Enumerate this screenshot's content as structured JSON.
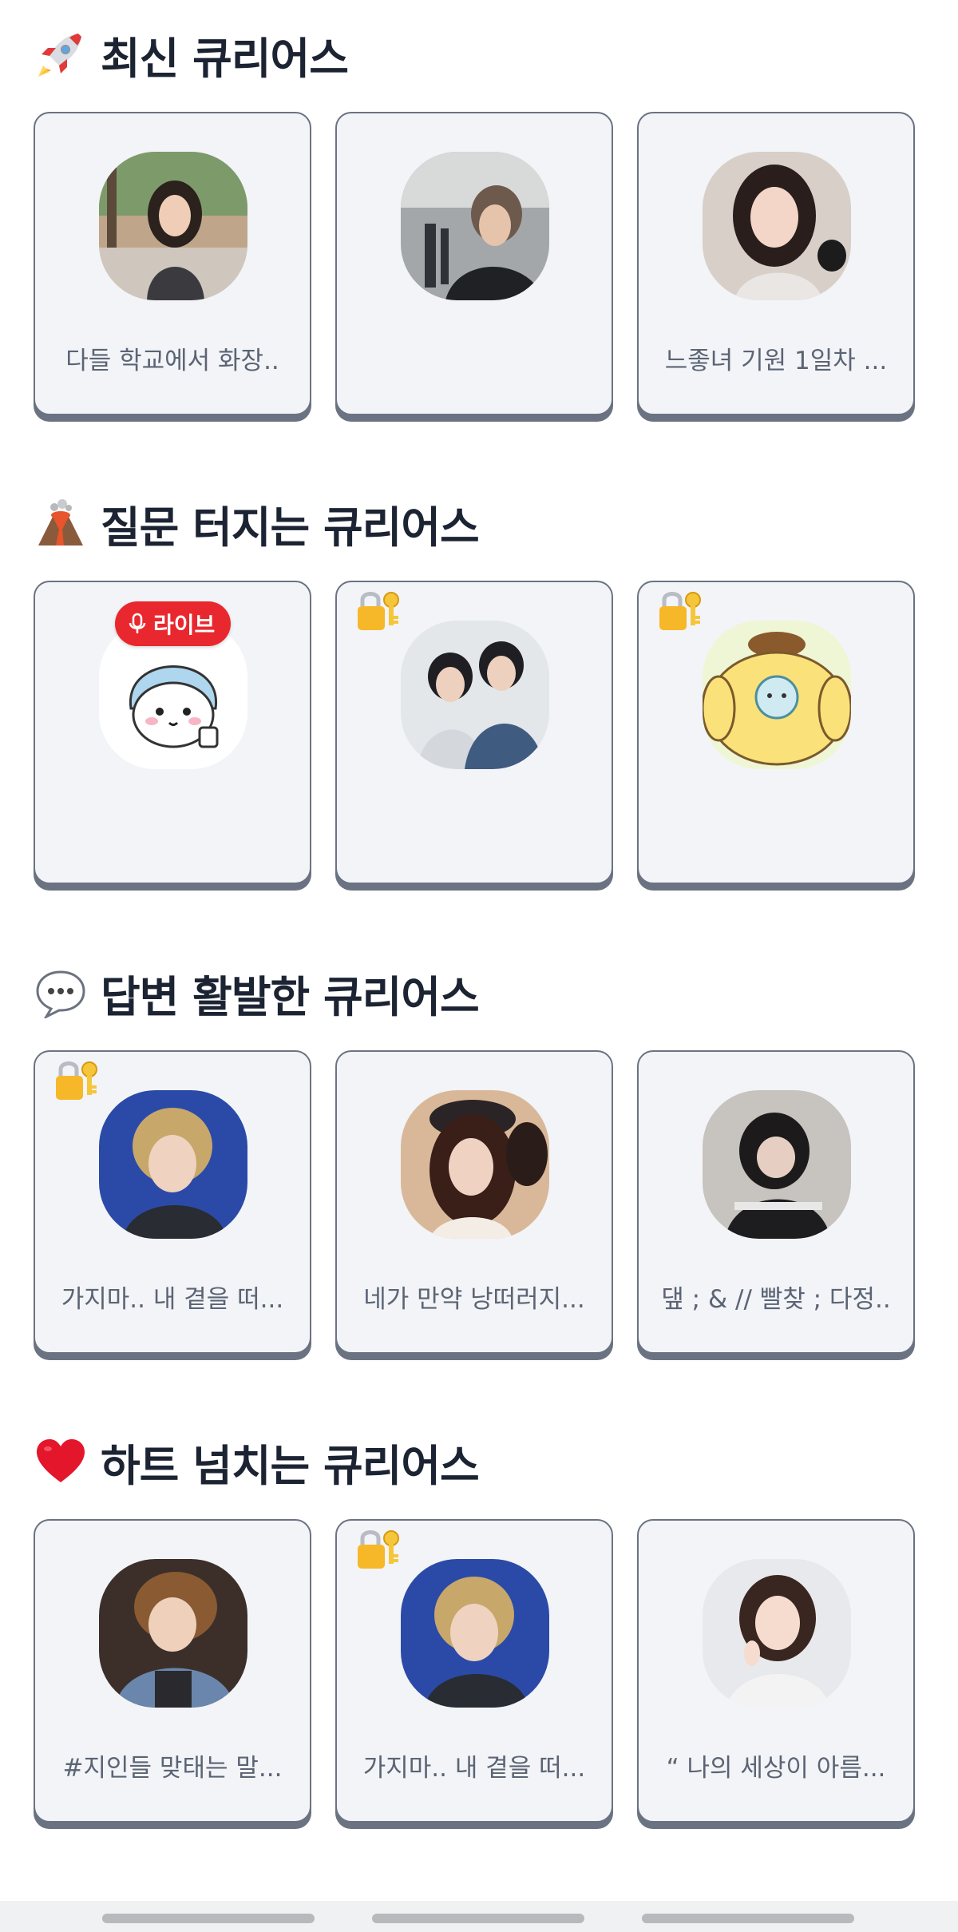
{
  "sections": [
    {
      "title": "최신 큐리어스",
      "icon": "rocket-icon",
      "cards": [
        {
          "caption": "다들 학교에서 화장..",
          "locked": false,
          "badge": ""
        },
        {
          "caption": "",
          "locked": false,
          "badge": ""
        },
        {
          "caption": "느좋녀 기원 1일차 ...",
          "locked": false,
          "badge": ""
        }
      ]
    },
    {
      "title": "질문 터지는 큐리어스",
      "icon": "volcano-icon",
      "cards": [
        {
          "caption": "",
          "locked": false,
          "badge": "라이브"
        },
        {
          "caption": "",
          "locked": true,
          "badge": ""
        },
        {
          "caption": "",
          "locked": true,
          "badge": ""
        }
      ]
    },
    {
      "title": "답변 활발한 큐리어스",
      "icon": "speech-bubble-icon",
      "cards": [
        {
          "caption": "가지마.. 내 곁을 떠...",
          "locked": true,
          "badge": ""
        },
        {
          "caption": "네가 만약 낭떠러지...",
          "locked": false,
          "badge": ""
        },
        {
          "caption": "댚 ; & // 빨찾 ; 다정..",
          "locked": false,
          "badge": ""
        }
      ]
    },
    {
      "title": "하트 넘치는 큐리어스",
      "icon": "heart-icon",
      "cards": [
        {
          "caption": "#지인들 맞태는 말...",
          "locked": false,
          "badge": ""
        },
        {
          "caption": "가지마.. 내 곁을 떠...",
          "locked": true,
          "badge": ""
        },
        {
          "caption": "“ 나의 세상이 아름...",
          "locked": false,
          "badge": ""
        }
      ]
    }
  ],
  "colors": {
    "card_background": "#f2f4f7",
    "card_border": "#6b7382",
    "live_badge": "#e8282e",
    "title_text": "#1c2433",
    "caption_text": "#5b6474"
  }
}
